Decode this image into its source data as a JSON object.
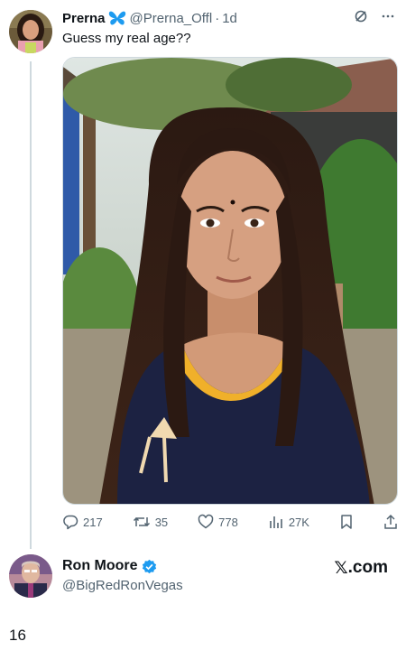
{
  "tweet": {
    "display_name": "Prerna",
    "handle": "@Prerna_Offl",
    "separator": "·",
    "time": "1d",
    "text": "Guess my real age??"
  },
  "actions": {
    "replies": "217",
    "reposts": "35",
    "likes": "778",
    "views": "27K"
  },
  "reply": {
    "display_name": "Ron Moore",
    "handle": "@BigRedRonVegas",
    "verified": true
  },
  "watermark": {
    "brand_letter": "𝕏",
    "brand_suffix": ".com"
  },
  "footer": {
    "page_number": "16"
  },
  "colors": {
    "text": "#0f1419",
    "muted": "#536471",
    "verified_blue": "#1d9bf0",
    "butterfly_blue": "#1d9bf0"
  },
  "icons": [
    "butterfly-icon",
    "grok-icon",
    "more-icon",
    "reply-icon",
    "repost-icon",
    "like-icon",
    "views-icon",
    "bookmark-icon",
    "share-icon",
    "verified-badge-icon"
  ]
}
